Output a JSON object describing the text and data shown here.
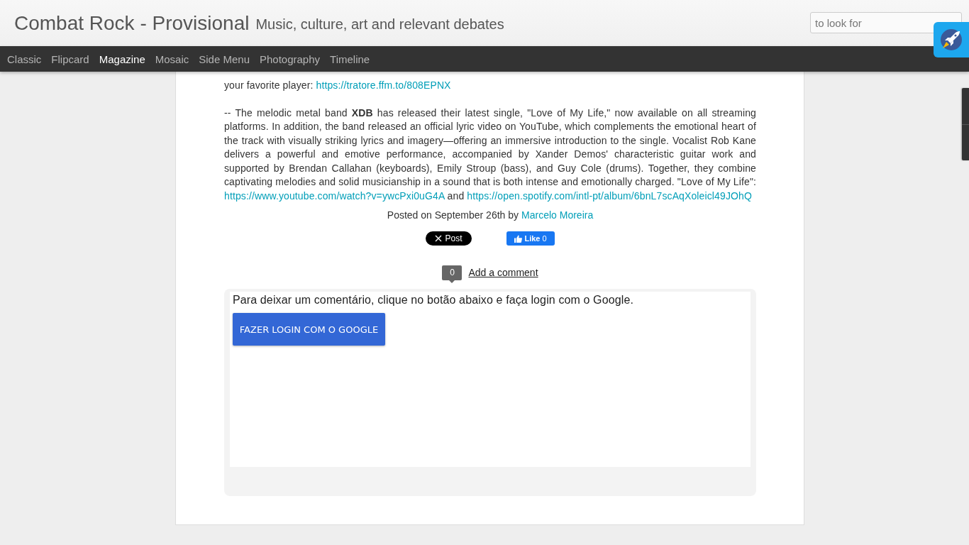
{
  "header": {
    "title": "Combat Rock - Provisional",
    "subtitle": "Music, culture, art and relevant debates",
    "search": {
      "placeholder": "to look for"
    }
  },
  "nav": {
    "items": [
      {
        "label": "Classic",
        "selected": false
      },
      {
        "label": "Flipcard",
        "selected": false
      },
      {
        "label": "Magazine",
        "selected": true
      },
      {
        "label": "Mosaic",
        "selected": false
      },
      {
        "label": "Side Menu",
        "selected": false
      },
      {
        "label": "Photography",
        "selected": false
      },
      {
        "label": "Timeline",
        "selected": false
      }
    ]
  },
  "post": {
    "paragraphs": [
      [
        {
          "kind": "text",
          "text": "your favorite player: "
        },
        {
          "kind": "link",
          "text": "https://tratore.ffm.to/808EPNX"
        }
      ],
      [
        {
          "kind": "text",
          "text": "-- The melodic metal band **XDB** has released their latest single, \"Love of My Life,\" now available on all streaming platforms. In addition, the band released an official lyric video on YouTube, which complements the emotional heart of the track with visually striking lyrics and imagery—offering an immersive introduction to the single. Vocalist Rob Kane delivers a powerful and emotive performance, accompanied by Xander Demos' characteristic guitar work and supported by Brendan Callahan (keyboards), Emily Stroup (bass), and Guy Cole (drums). Together, they combine captivating melodies and solid musicianship in a sound that is both intense and emotionally charged. \"Love of My Life\": "
        },
        {
          "kind": "link",
          "text": "https://www.youtube.com/watch?v=ywcPxi0uG4A"
        },
        {
          "kind": "text",
          "text": "  and "
        },
        {
          "kind": "link",
          "text": "https://open.spotify.com/intl-pt/album/6bnL7scAqXoleicl49JOhQ"
        }
      ]
    ],
    "byline": {
      "text": "Posted on September 26th by",
      "author": "Marcelo Moreira"
    },
    "share": [
      {
        "kind": "x",
        "label": "Post"
      },
      {
        "kind": "facebook",
        "label": "Like",
        "count": "0"
      }
    ],
    "comments": {
      "count": "0",
      "link": "Add a comment",
      "prompt": "Para deixar um comentário, clique no botão abaixo e faça login com o Google.",
      "button": "FAZER LOGIN COM O GOOGLE"
    }
  }
}
